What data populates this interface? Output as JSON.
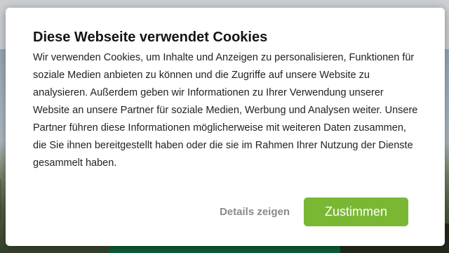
{
  "cookie_dialog": {
    "title": "Diese Webseite verwendet Cookies",
    "body": "Wir verwenden Cookies, um Inhalte und Anzeigen zu personalisieren, Funktionen für soziale Medien anbieten zu können und die Zugriffe auf unsere Website zu analysieren. Außerdem geben wir Informationen zu Ihrer Verwendung unserer Website an unsere Partner für soziale Medien, Werbung und Analysen weiter. Unsere Partner führen diese Informationen möglicherweise mit weiteren Daten zusammen, die Sie ihnen bereitgestellt haben oder die sie im Rahmen Ihrer Nutzung der Dienste gesammelt haben.",
    "details_label": "Details zeigen",
    "accept_label": "Zustimmen"
  },
  "colors": {
    "accept_button": "#7ab833",
    "details_text": "#8a8a8a",
    "background_green": "#0e6b3f"
  }
}
